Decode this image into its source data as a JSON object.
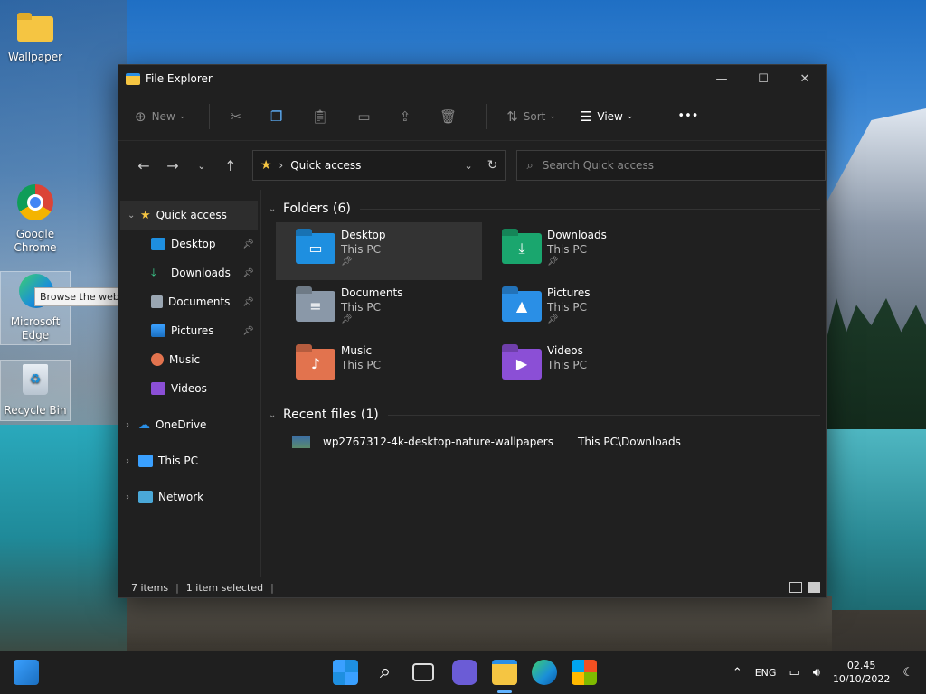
{
  "desktop": {
    "icons": [
      {
        "label": "Wallpaper"
      },
      {
        "label": "Google Chrome"
      },
      {
        "label": "Microsoft Edge"
      },
      {
        "label": "Recycle Bin"
      }
    ],
    "tooltip": "Browse the web"
  },
  "window": {
    "title": "File Explorer",
    "toolbar": {
      "new_label": "New",
      "sort_label": "Sort",
      "view_label": "View",
      "more_label": "•••"
    },
    "address": {
      "path": "Quick access"
    },
    "search": {
      "placeholder": "Search Quick access"
    },
    "nav": {
      "quick_access": "Quick access",
      "items": [
        {
          "label": "Desktop",
          "pinned": true
        },
        {
          "label": "Downloads",
          "pinned": true
        },
        {
          "label": "Documents",
          "pinned": true
        },
        {
          "label": "Pictures",
          "pinned": true
        },
        {
          "label": "Music",
          "pinned": false
        },
        {
          "label": "Videos",
          "pinned": false
        }
      ],
      "onedrive": "OneDrive",
      "this_pc": "This PC",
      "network": "Network"
    },
    "folders_header": "Folders (6)",
    "folders": [
      {
        "name": "Desktop",
        "location": "This PC",
        "pinned": true,
        "color": "#1e8fe0"
      },
      {
        "name": "Downloads",
        "location": "This PC",
        "pinned": true,
        "color": "#1aa66e"
      },
      {
        "name": "Documents",
        "location": "This PC",
        "pinned": true,
        "color": "#8a98a8"
      },
      {
        "name": "Pictures",
        "location": "This PC",
        "pinned": true,
        "color": "#2a8fe6"
      },
      {
        "name": "Music",
        "location": "This PC",
        "pinned": false,
        "color": "#e2734e"
      },
      {
        "name": "Videos",
        "location": "This PC",
        "pinned": false,
        "color": "#8b4fd6"
      }
    ],
    "recent_header": "Recent files (1)",
    "recent": [
      {
        "name": "wp2767312-4k-desktop-nature-wallpapers",
        "path": "This PC\\Downloads"
      }
    ],
    "status": {
      "items": "7 items",
      "selected": "1 item selected"
    }
  },
  "taskbar": {
    "lang": "ENG",
    "time": "02.45",
    "date": "10/10/2022"
  }
}
